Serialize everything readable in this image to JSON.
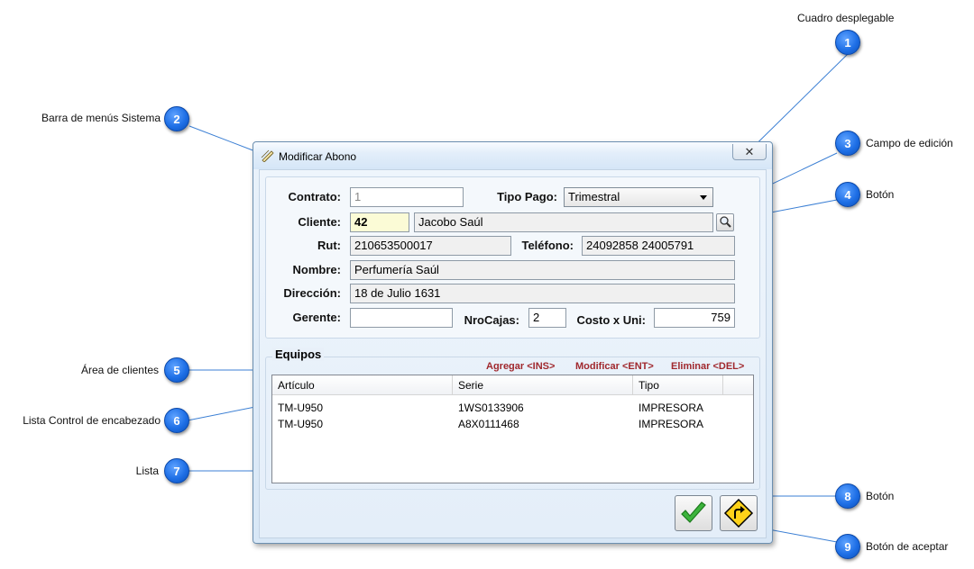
{
  "callouts": [
    {
      "num": "1",
      "label": "Cuadro desplegable"
    },
    {
      "num": "2",
      "label": "Barra de menús Sistema"
    },
    {
      "num": "3",
      "label": "Campo de edición"
    },
    {
      "num": "4",
      "label": "Botón"
    },
    {
      "num": "5",
      "label": "Área de clientes"
    },
    {
      "num": "6",
      "label": "Lista Control de encabezado"
    },
    {
      "num": "7",
      "label": "Lista"
    },
    {
      "num": "8",
      "label": "Botón"
    },
    {
      "num": "9",
      "label": "Botón de aceptar"
    }
  ],
  "window": {
    "title": "Modificar Abono",
    "close_glyph": "✕"
  },
  "form": {
    "contrato_label": "Contrato:",
    "contrato_value": "1",
    "tipo_pago_label": "Tipo Pago:",
    "tipo_pago_value": "Trimestral",
    "cliente_label": "Cliente:",
    "cliente_code": "42",
    "cliente_name": "Jacobo Saúl",
    "rut_label": "Rut:",
    "rut_value": "210653500017",
    "telefono_label": "Teléfono:",
    "telefono_value": "24092858 24005791",
    "nombre_label": "Nombre:",
    "nombre_value": "Perfumería Saúl",
    "direccion_label": "Dirección:",
    "direccion_value": "18 de Julio 1631",
    "gerente_label": "Gerente:",
    "gerente_value": "",
    "nrocajas_label": "NroCajas:",
    "nrocajas_value": "2",
    "costo_label": "Costo x Uni:",
    "costo_value": "759"
  },
  "equipos": {
    "title": "Equipos",
    "actions": {
      "agregar": "Agregar <INS>",
      "modificar": "Modificar <ENT>",
      "eliminar": "Eliminar <DEL>"
    },
    "columns": [
      "Artículo",
      "Serie",
      "Tipo"
    ],
    "rows": [
      [
        "TM-U950",
        "1WS0133906",
        "IMPRESORA"
      ],
      [
        "TM-U950",
        "A8X0111468",
        "IMPRESORA"
      ]
    ]
  },
  "colors": {
    "badge": "#1e6fe6",
    "action_link": "#a0282d",
    "leader_line": "#3b7fd4"
  }
}
